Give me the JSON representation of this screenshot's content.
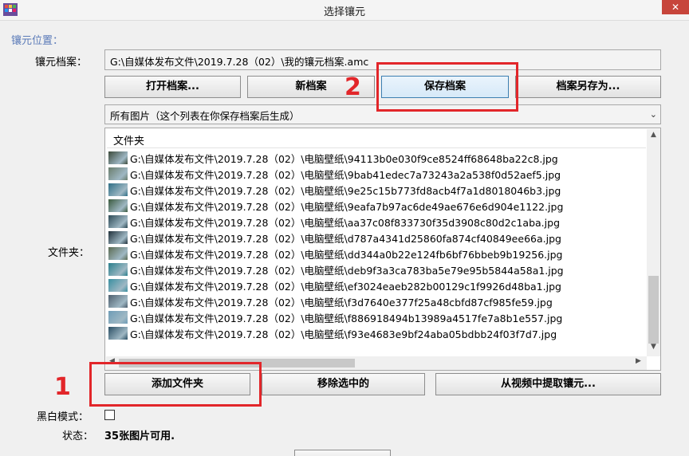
{
  "window": {
    "title": "选择镶元",
    "close_glyph": "✕"
  },
  "group_label": "镶元位置：",
  "archive": {
    "label": "镶元档案：",
    "path": "G:\\自媒体发布文件\\2019.7.28（02）\\我的镶元档案.amc"
  },
  "buttons": {
    "open": "打开档案...",
    "new": "新档案",
    "save": "保存档案",
    "save_as": "档案另存为...",
    "add_folder": "添加文件夹",
    "remove_selected": "移除选中的",
    "extract_video": "从视频中提取镶元..."
  },
  "filter_select": {
    "value": "所有图片（这个列表在你保存档案后生成）"
  },
  "folder_label": "文件夹：",
  "list": {
    "header": "文件夹",
    "rows": [
      "G:\\自媒体发布文件\\2019.7.28（02）\\电脑壁纸\\94113b0e030f9ce8524ff68648ba22c8.jpg",
      "G:\\自媒体发布文件\\2019.7.28（02）\\电脑壁纸\\9bab41edec7a73243a2a538f0d52aef5.jpg",
      "G:\\自媒体发布文件\\2019.7.28（02）\\电脑壁纸\\9e25c15b773fd8acb4f7a1d8018046b3.jpg",
      "G:\\自媒体发布文件\\2019.7.28（02）\\电脑壁纸\\9eafa7b97ac6de49ae676e6d904e1122.jpg",
      "G:\\自媒体发布文件\\2019.7.28（02）\\电脑壁纸\\aa37c08f833730f35d3908c80d2c1aba.jpg",
      "G:\\自媒体发布文件\\2019.7.28（02）\\电脑壁纸\\d787a4341d25860fa874cf40849ee66a.jpg",
      "G:\\自媒体发布文件\\2019.7.28（02）\\电脑壁纸\\dd344a0b22e124fb6bf76bbeb9b19256.jpg",
      "G:\\自媒体发布文件\\2019.7.28（02）\\电脑壁纸\\deb9f3a3ca783ba5e79e95b5844a58a1.jpg",
      "G:\\自媒体发布文件\\2019.7.28（02）\\电脑壁纸\\ef3024eaeb282b00129c1f9926d48ba1.jpg",
      "G:\\自媒体发布文件\\2019.7.28（02）\\电脑壁纸\\f3d7640e377f25a48cbfd87cf985fe59.jpg",
      "G:\\自媒体发布文件\\2019.7.28（02）\\电脑壁纸\\f886918494b13989a4517fe7a8b1e557.jpg",
      "G:\\自媒体发布文件\\2019.7.28（02）\\电脑壁纸\\f93e4683e9bf24aba05bdbb24f03f7d7.jpg"
    ]
  },
  "bw_mode": {
    "label": "黑白模式：",
    "checked": false
  },
  "status": {
    "label": "状态：",
    "value": "35张图片可用."
  },
  "annotations": {
    "one": "1",
    "two": "2",
    "color": "#e2262a"
  },
  "thumb_colors": [
    "#3c4a3a",
    "#6a7d6c",
    "#2f6f86",
    "#3b5a3e",
    "#2d4a56",
    "#20303a",
    "#5b6b52",
    "#2a7f8c",
    "#3a8fa0",
    "#4e5f6e",
    "#6e9cb6",
    "#2b4f64"
  ]
}
